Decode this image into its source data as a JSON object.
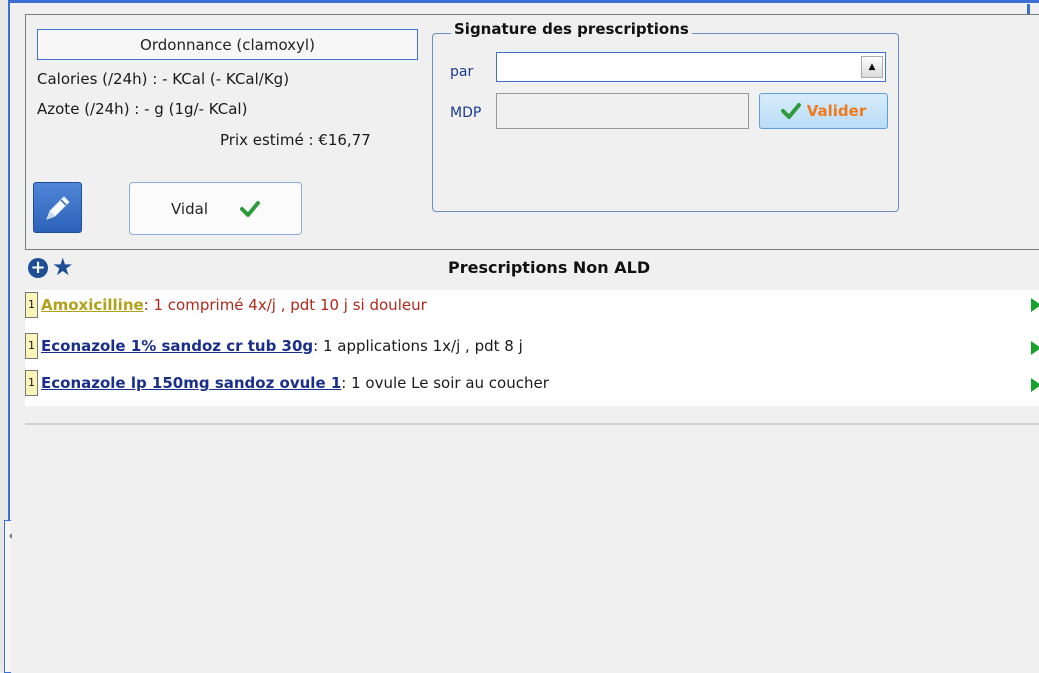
{
  "ordonnance": {
    "title": "Ordonnance (clamoxyl)",
    "calories": "Calories (/24h) : - KCal (- KCal/Kg)",
    "azote": "Azote (/24h) : - g (1g/- KCal)",
    "prix": "Prix estimé : €16,77"
  },
  "actions": {
    "edit_icon": "pencil-icon",
    "vidal_label": "Vidal",
    "vidal_icon": "green-check-icon"
  },
  "signature": {
    "legend": "Signature des prescriptions",
    "par_label": "par",
    "par_value": "",
    "mdp_label": "MDP",
    "mdp_value": "",
    "valider_label": "Valider"
  },
  "prescriptions": {
    "title": "Prescriptions Non ALD",
    "rows": [
      {
        "qty": "1",
        "drug": "Amoxicilline",
        "posology": " : 1 comprimé 4x/j , pdt 10 j si douleur",
        "drug_color": "yellow",
        "posology_color": "red"
      },
      {
        "qty": "1",
        "drug": "Econazole 1% sandoz cr tub 30g",
        "posology": " : 1 applications 1x/j , pdt 8 j",
        "drug_color": "blue",
        "posology_color": "default"
      },
      {
        "qty": "1",
        "drug": "Econazole lp 150mg sandoz ovule 1",
        "posology": " : 1 ovule  Le soir au coucher",
        "drug_color": "blue",
        "posology_color": "default"
      }
    ]
  },
  "colors": {
    "accent_blue": "#3b6fd1",
    "valider_text": "#f07a1a",
    "play_green": "#18a12c",
    "qty_bg": "#fbf5b8"
  }
}
